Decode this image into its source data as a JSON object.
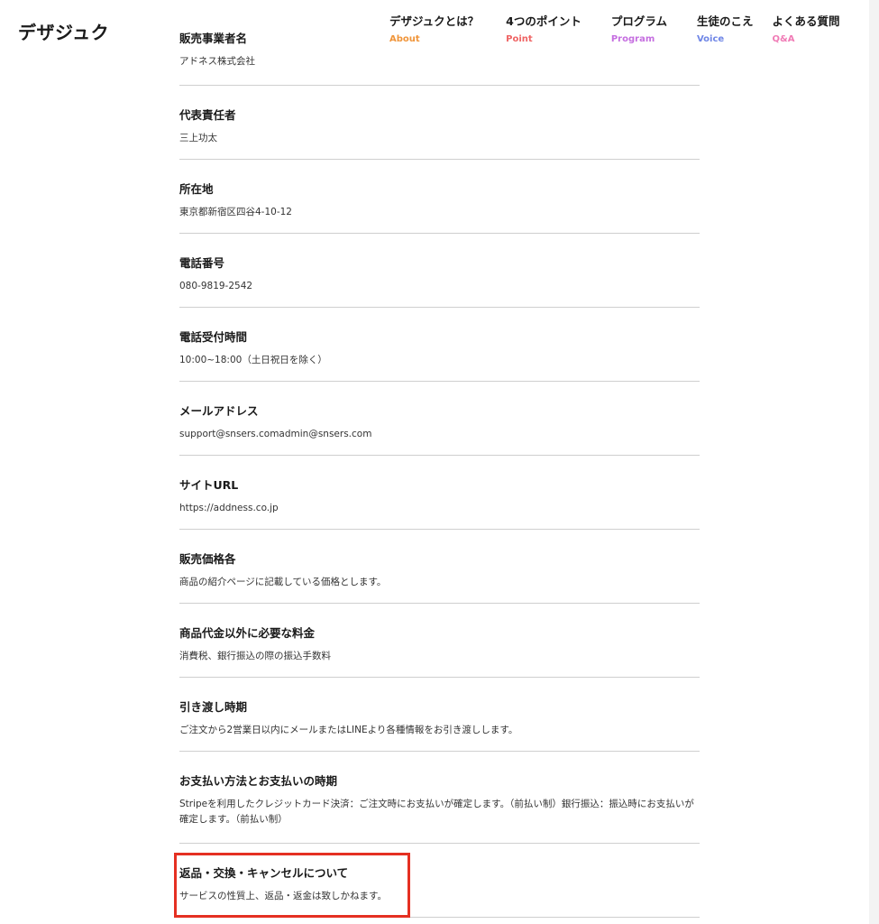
{
  "header": {
    "logo": "デザジュク",
    "nav": [
      {
        "jp": "デザジュクとは？",
        "en": "About",
        "color": "#f0953a"
      },
      {
        "jp": "4つのポイント",
        "en": "Point",
        "color": "#ef6464"
      },
      {
        "jp": "プログラム",
        "en": "Program",
        "color": "#c56ee0"
      },
      {
        "jp": "生徒のこえ",
        "en": "Voice",
        "color": "#6f86e6"
      },
      {
        "jp": "よくある質問",
        "en": "Q&A",
        "color": "#f07ab5"
      }
    ]
  },
  "rows": [
    {
      "title": "販売事業者名",
      "value": "アドネス株式会社"
    },
    {
      "title": "代表責任者",
      "value": "三上功太"
    },
    {
      "title": "所在地",
      "value": "東京都新宿区四谷4-10-12"
    },
    {
      "title": "電話番号",
      "value": "080-9819-2542"
    },
    {
      "title": "電話受付時間",
      "value": "10:00~18:00（土日祝日を除く）"
    },
    {
      "title": "メールアドレス",
      "value": "support@snsers.comadmin@snsers.com"
    },
    {
      "title": "サイトURL",
      "value": "https://addness.co.jp"
    },
    {
      "title": "販売価格各",
      "value": "商品の紹介ページに記載している価格とします。"
    },
    {
      "title": "商品代金以外に必要な料金",
      "value": "消費税、銀行振込の際の振込手数料"
    },
    {
      "title": "引き渡し時期",
      "value": "ご注文から2営業日以内にメールまたはLINEより各種情報をお引き渡しします。"
    },
    {
      "title": "お支払い方法とお支払いの時期",
      "value": "Stripeを利用したクレジットカード決済：ご注文時にお支払いが確定します。（前払い制）銀行振込：振込時にお支払いが確定します。（前払い制）"
    },
    {
      "title": "返品・交換・キャンセルについて",
      "value": "サービスの性質上、返品・返金は致しかねます。"
    }
  ],
  "highlight_color": "#e53022"
}
